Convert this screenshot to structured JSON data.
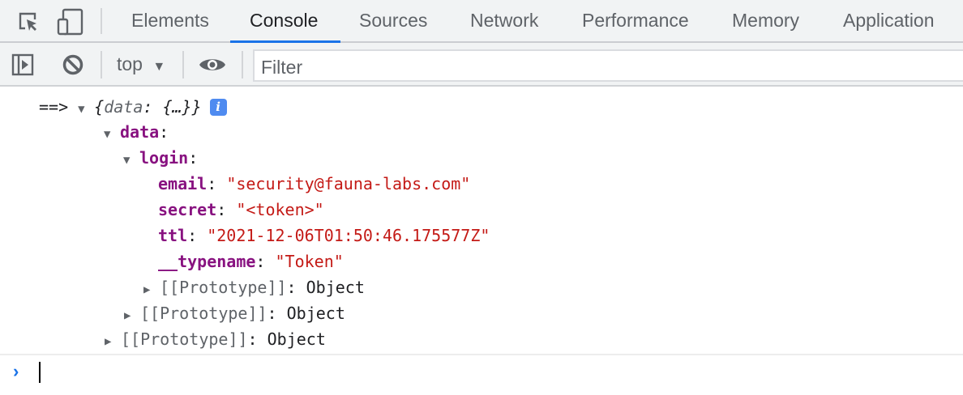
{
  "tabs": [
    "Elements",
    "Console",
    "Sources",
    "Network",
    "Performance",
    "Memory",
    "Application"
  ],
  "active_tab": "Console",
  "toolbar": {
    "context": "top",
    "filter_placeholder": "Filter"
  },
  "console": {
    "prefix": "==>",
    "summary_open": "{",
    "summary_key": "data",
    "summary_rest": ": {…}}",
    "info_badge": "i",
    "data_key": "data",
    "login_key": "login",
    "fields": [
      {
        "key": "email",
        "value": "\"security@fauna-labs.com\""
      },
      {
        "key": "secret",
        "value": "\"<token>\""
      },
      {
        "key": "ttl",
        "value": "\"2021-12-06T01:50:46.175577Z\""
      },
      {
        "key": "__typename",
        "value": "\"Token\""
      }
    ],
    "proto_label": "[[Prototype]]",
    "proto_value": "Object",
    "colon": ": "
  },
  "prompt_symbol": "›"
}
